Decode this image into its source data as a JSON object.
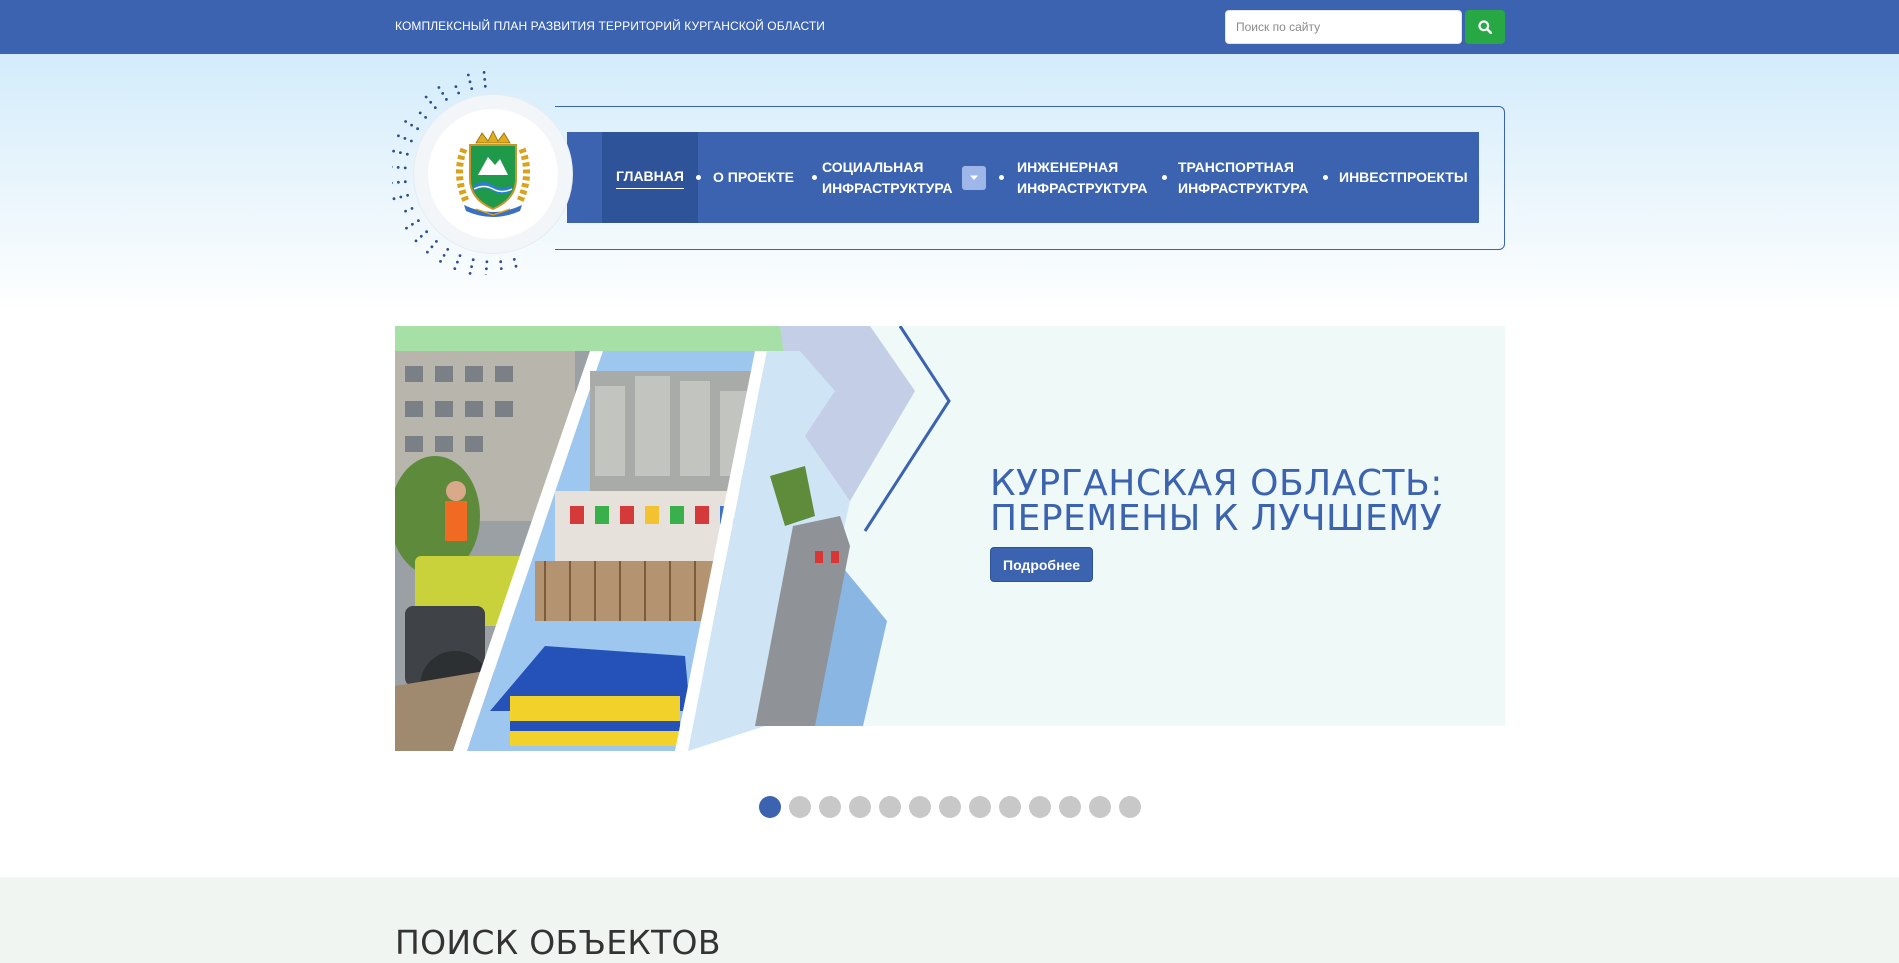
{
  "topbar": {
    "site_title": "КОМПЛЕКСНЫЙ ПЛАН РАЗВИТИЯ ТЕРРИТОРИЙ КУРГАНСКОЙ ОБЛАСТИ",
    "search_placeholder": "Поиск по сайту",
    "search_icon": "search-icon"
  },
  "nav": {
    "items": [
      {
        "label": "ГЛАВНАЯ",
        "active": true
      },
      {
        "label": "О ПРОЕКТЕ"
      },
      {
        "line1": "СОЦИАЛЬНАЯ",
        "line2": "ИНФРАСТРУКТУРА",
        "has_dropdown": true
      },
      {
        "line1": "ИНЖЕНЕРНАЯ",
        "line2": "ИНФРАСТРУКТУРА"
      },
      {
        "line1": "ТРАНСПОРТНАЯ",
        "line2": "ИНФРАСТРУКТУРА"
      },
      {
        "label": "ИНВЕСТПРОЕКТЫ"
      }
    ]
  },
  "slider": {
    "heading_line1": "КУРГАНСКАЯ ОБЛАСТЬ:",
    "heading_line2": "ПЕРЕМЕНЫ К ЛУЧШЕМУ",
    "button_label": "Подробнее",
    "slide_count": 13,
    "active_slide": 1
  },
  "objects": {
    "title": "ПОИСК ОБЪЕКТОВ"
  },
  "colors": {
    "primary": "#3c63b0",
    "primary_dark": "#2f5399",
    "search_button": "#28a745",
    "dot_inactive": "#c8c8c8"
  }
}
